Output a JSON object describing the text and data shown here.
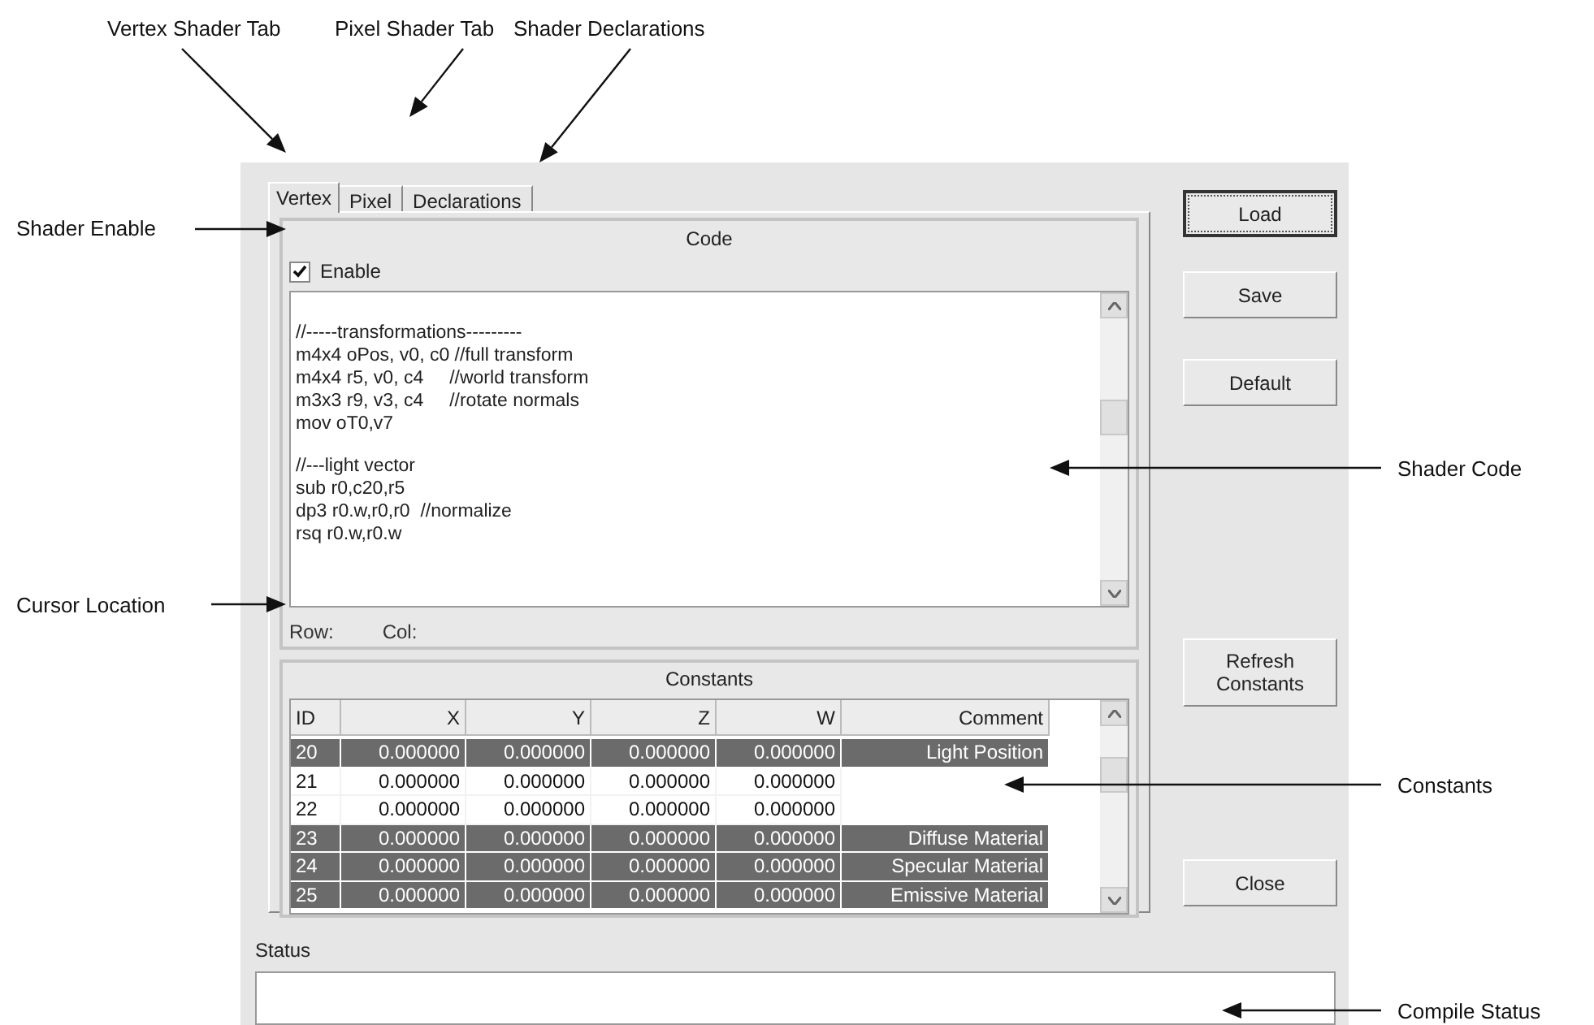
{
  "callouts": [
    {
      "text": "Vertex Shader Tab"
    },
    {
      "text": "Pixel Shader Tab"
    },
    {
      "text": "Shader Declarations"
    },
    {
      "text": "Shader Enable"
    },
    {
      "text": "Cursor Location"
    },
    {
      "text": "Shader Code"
    },
    {
      "text": "Constants"
    },
    {
      "text": "Compile Status"
    }
  ],
  "tabs": [
    {
      "label": "Vertex",
      "selected": true
    },
    {
      "label": "Pixel",
      "selected": false
    },
    {
      "label": "Declarations",
      "selected": false
    }
  ],
  "code": {
    "title": "Code",
    "enable": {
      "label": "Enable",
      "checked": true
    },
    "paragraphs": [
      [
        "//-----transformations---------",
        "m4x4 oPos, v0, c0 //full transform",
        "m4x4 r5, v0, c4     //world transform",
        "m3x3 r9, v3, c4     //rotate normals",
        "mov oT0,v7"
      ],
      [
        "//---light vector",
        "sub r0,c20,r5",
        "dp3 r0.w,r0,r0  //normalize",
        "rsq r0.w,r0.w"
      ]
    ],
    "row_label": "Row:",
    "col_label": "Col:"
  },
  "constants": {
    "title": "Constants",
    "columns": [
      "ID",
      "X",
      "Y",
      "Z",
      "W",
      "Comment"
    ],
    "rows": [
      {
        "cells": [
          "20",
          "0.000000",
          "0.000000",
          "0.000000",
          "0.000000",
          "Light Position"
        ],
        "selected": true
      },
      {
        "cells": [
          "21",
          "0.000000",
          "0.000000",
          "0.000000",
          "0.000000"
        ],
        "selected": false
      },
      {
        "cells": [
          "22",
          "0.000000",
          "0.000000",
          "0.000000",
          "0.000000"
        ],
        "selected": false
      },
      {
        "cells": [
          "23",
          "0.000000",
          "0.000000",
          "0.000000",
          "0.000000",
          "Diffuse Material"
        ],
        "selected": true
      },
      {
        "cells": [
          "24",
          "0.000000",
          "0.000000",
          "0.000000",
          "0.000000",
          "Specular Material"
        ],
        "selected": true
      },
      {
        "cells": [
          "25",
          "0.000000",
          "0.000000",
          "0.000000",
          "0.000000",
          "Emissive Material"
        ],
        "selected": true
      }
    ]
  },
  "buttons": [
    {
      "label": "Load",
      "focused": true
    },
    {
      "label": "Save",
      "focused": false
    },
    {
      "label": "Default",
      "focused": false
    },
    {
      "label": "Refresh Constants",
      "focused": false
    },
    {
      "label": "Close",
      "focused": false
    }
  ],
  "status": {
    "label": "Status"
  }
}
